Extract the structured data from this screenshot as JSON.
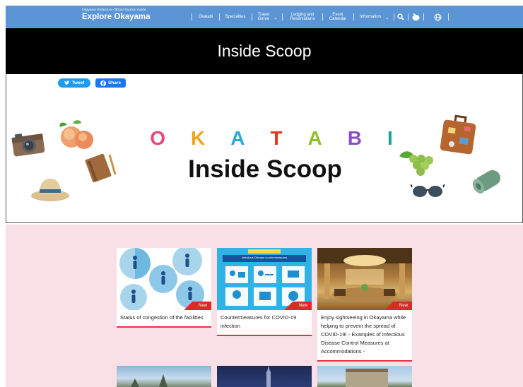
{
  "nav": {
    "logo_sub": "Okayama Prefecture Official Tourism Guide",
    "logo_main": "Explore Okayama",
    "items": [
      {
        "label": "Okatabi"
      },
      {
        "label": "Specialties"
      },
      {
        "label": "Travel\nGenre"
      },
      {
        "label": "Lodging and\nReservations"
      },
      {
        "label": "Event\nCalendar"
      },
      {
        "label": "Information"
      }
    ],
    "icons": [
      "search-icon",
      "peach-icon",
      "globe-icon"
    ]
  },
  "band": {
    "title": "Inside Scoop"
  },
  "share": {
    "tweet": "Tweet",
    "share": "Share"
  },
  "hero": {
    "brand_letters": [
      "O",
      "K",
      "A",
      "T",
      "A",
      "B",
      "I"
    ],
    "brand_colors": [
      "#e6477a",
      "#f0a31c",
      "#2aa6d9",
      "#e5341d",
      "#8ebf2a",
      "#8a4fc4",
      "#1aa39a"
    ],
    "title": "Inside Scoop"
  },
  "cards": [
    {
      "caption": "Status of congestion of the facilities",
      "badge": "New"
    },
    {
      "caption": "Countermeasures for COVID-19 infection",
      "badge": "New"
    },
    {
      "caption": "Enjoy sightseeing in Okayama while helping to prevent the spread of COVID-19! - Examples of Infectious Disease Control Measures at Accommodations -",
      "badge": "New"
    }
  ],
  "covid_poster": {
    "header": "Infectious Disease countermeasures"
  },
  "colors": {
    "nav": "#5b95d5",
    "band": "#000000",
    "pink": "#f9dfe6",
    "accent_red": "#d92b2b"
  }
}
